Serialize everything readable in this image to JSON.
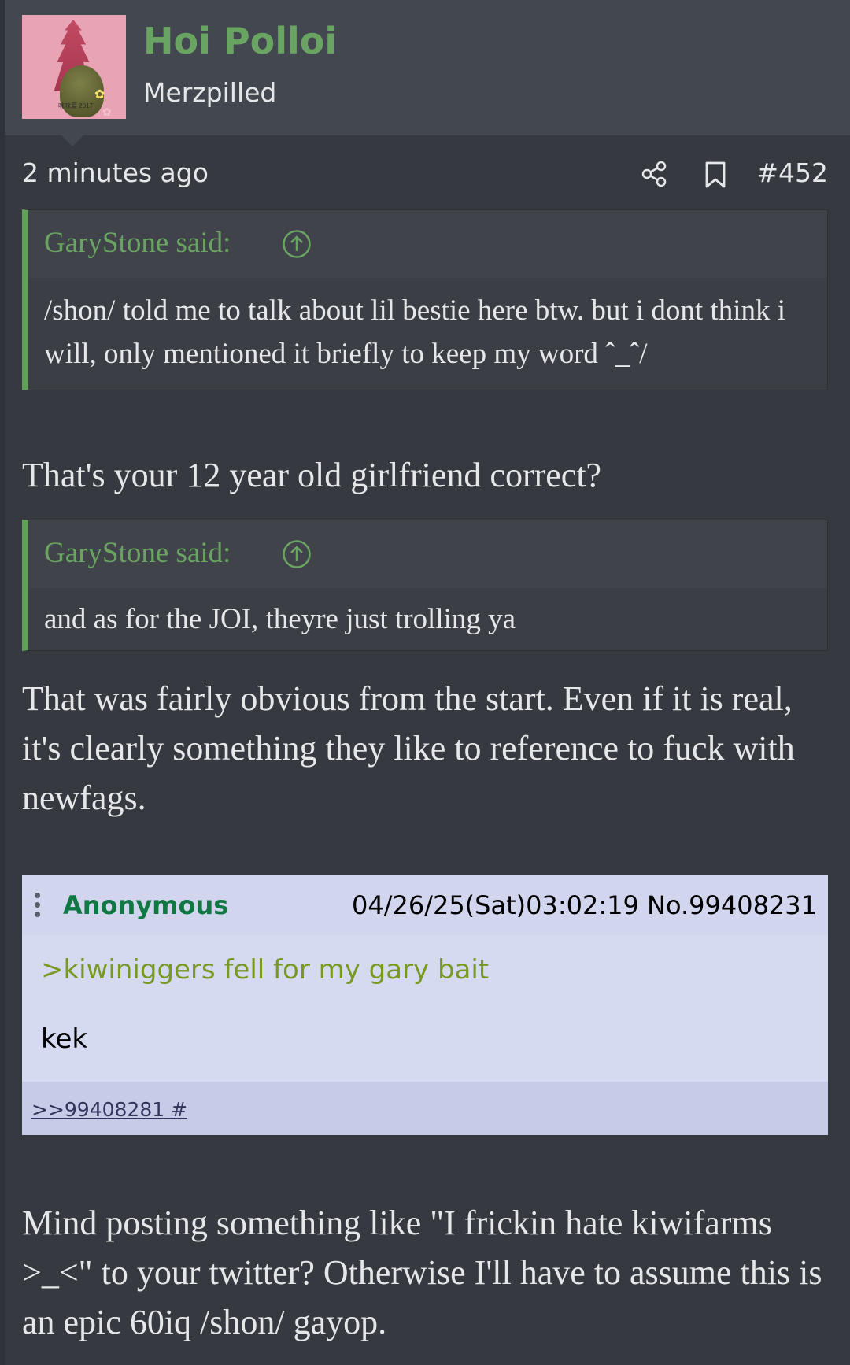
{
  "user": {
    "name": "Hoi Polloi",
    "title": "Merzpilled",
    "avatar_watermark": "咪咪爱 2017"
  },
  "post": {
    "time": "2 minutes ago",
    "number": "#452"
  },
  "quote1": {
    "author": "GaryStone said:",
    "text": "/shon/ told me to talk about lil bestie here btw. but i dont think i will, only mentioned it briefly to keep my word ˆ_ˆ/"
  },
  "reply1": "That's your 12 year old girlfriend correct?",
  "quote2": {
    "author": "GaryStone said:",
    "text": "and as for the JOI, theyre just trolling ya"
  },
  "reply2": "That was fairly obvious from the start. Even if it is real, it's clearly something they like to reference to fuck with newfags.",
  "embedded_post": {
    "name": "Anonymous",
    "datetime": "04/26/25(Sat)03:02:19 No.99408231",
    "greentext": ">kiwiniggers fell for my gary bait",
    "text": "kek",
    "reply_link": ">>99408281 #"
  },
  "reply3": "Mind posting something like \"I frickin hate kiwifarms >_<\" to your twitter? Otherwise I'll have to assume this is an epic 60iq /shon/ gayop.",
  "colors": {
    "background": "#363940",
    "header_bg": "#43474f",
    "accent_green": "#6aa463",
    "quote_bar": "#61a15a",
    "embed_bg": "#d6daf0",
    "embed_name": "#117743",
    "greentext": "#789922"
  },
  "icons": [
    "share-icon",
    "bookmark-icon",
    "expand-quote-icon",
    "more-options-icon"
  ]
}
